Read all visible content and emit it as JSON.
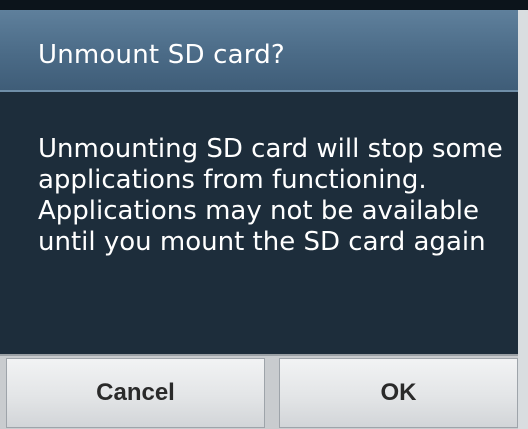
{
  "dialog": {
    "title": "Unmount SD card?",
    "message": "Unmounting SD card will stop some applications from functioning. Applications may not be available until you mount the SD card again",
    "buttons": {
      "cancel_label": "Cancel",
      "ok_label": "OK"
    }
  },
  "colors": {
    "title_bar": "#4b6b87",
    "body_background": "#1d2d3b",
    "button_background": "#e3e5e7",
    "button_text": "#2a2a2a"
  }
}
